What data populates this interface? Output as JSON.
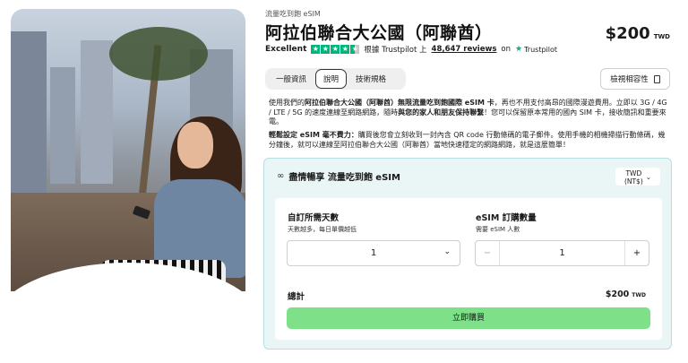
{
  "breadcrumb": "流量吃到飽 eSIM",
  "title": "阿拉伯聯合大公國（阿聯酋）",
  "price": {
    "amount": "$200",
    "currency": "TWD"
  },
  "rating": {
    "word": "Excellent",
    "stars": 4.5,
    "prefix": "根據 Trustpilot 上",
    "reviews": "48,647 reviews",
    "on": "on",
    "brand": "Trustpilot"
  },
  "tabs": [
    {
      "label": "一般資訊"
    },
    {
      "label": "說明"
    },
    {
      "label": "技術規格"
    }
  ],
  "compat_button": "檢視相容性",
  "description": {
    "p1_a": "使用我們的",
    "p1_b": "阿拉伯聯合大公國（阿聯酋）無限流量吃到飽國際 eSIM 卡",
    "p1_c": "，再也不用支付高昂的國際漫遊費用。立即以 3G / 4G / LTE / 5G 的速度連線至網路網路，隨時",
    "p1_d": "與您的家人和朋友保持聯繫",
    "p1_e": "！您可以保留原本常用的國內 SIM 卡，接收簡訊和重要來電。",
    "p2_a": "輕鬆設定 eSIM 毫不費力：",
    "p2_b": "購買後您會立刻收到一封內含 QR code 行動條碼的電子郵件。使用手機的相機掃描行動條碼，幾分鐘後，就可以連線至阿拉伯聯合大公國（阿聯酋）當地快速穩定的網路網路，就是這麼簡單！"
  },
  "purchase": {
    "header": "盡情暢享 流量吃到飽 eSIM",
    "currency_select": "TWD\n(NT$)",
    "days_label": "自訂所需天數",
    "days_sub": "天數越多，每日單價越低",
    "days_value": "1",
    "qty_label": "eSIM 訂購數量",
    "qty_sub": "需要 eSIM 人數",
    "qty_value": "1",
    "total_label": "總計",
    "total_amount": "$200",
    "total_currency": "TWD",
    "buy_label": "立即購買"
  },
  "colors": {
    "accent_green": "#7fe08a",
    "box_bg": "#eaf5f6",
    "trustpilot": "#00b67a"
  }
}
